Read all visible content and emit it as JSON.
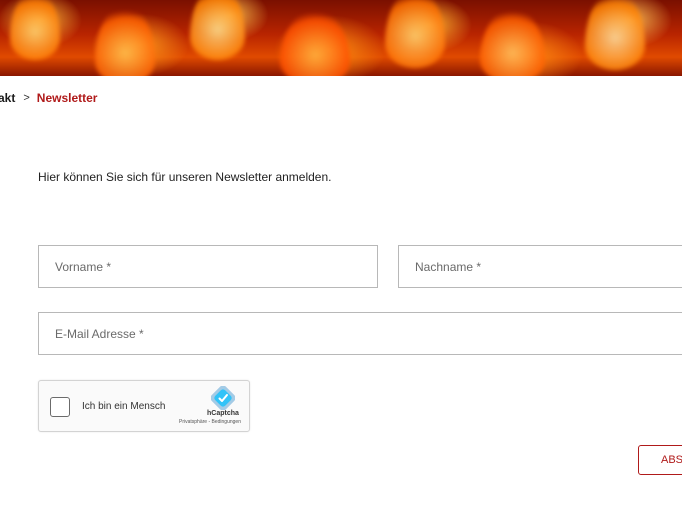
{
  "breadcrumb": {
    "prev_label": "akt",
    "separator": ">",
    "current_label": "Newsletter"
  },
  "intro_text": "Hier können Sie sich für unseren Newsletter anmelden.",
  "form": {
    "firstname_placeholder": "Vorname *",
    "lastname_placeholder": "Nachname *",
    "email_placeholder": "E-Mail Adresse *",
    "firstname_value": "",
    "lastname_value": "",
    "email_value": ""
  },
  "captcha": {
    "label": "Ich bin ein Mensch",
    "brand": "hCaptcha",
    "links": "Privatsphäre - Bedingungen",
    "icon": "hcaptcha-logo-icon"
  },
  "submit_label": "ABSENDEN",
  "colors": {
    "accent": "#b01a1a",
    "border": "#b8b8b8",
    "text": "#222222"
  }
}
